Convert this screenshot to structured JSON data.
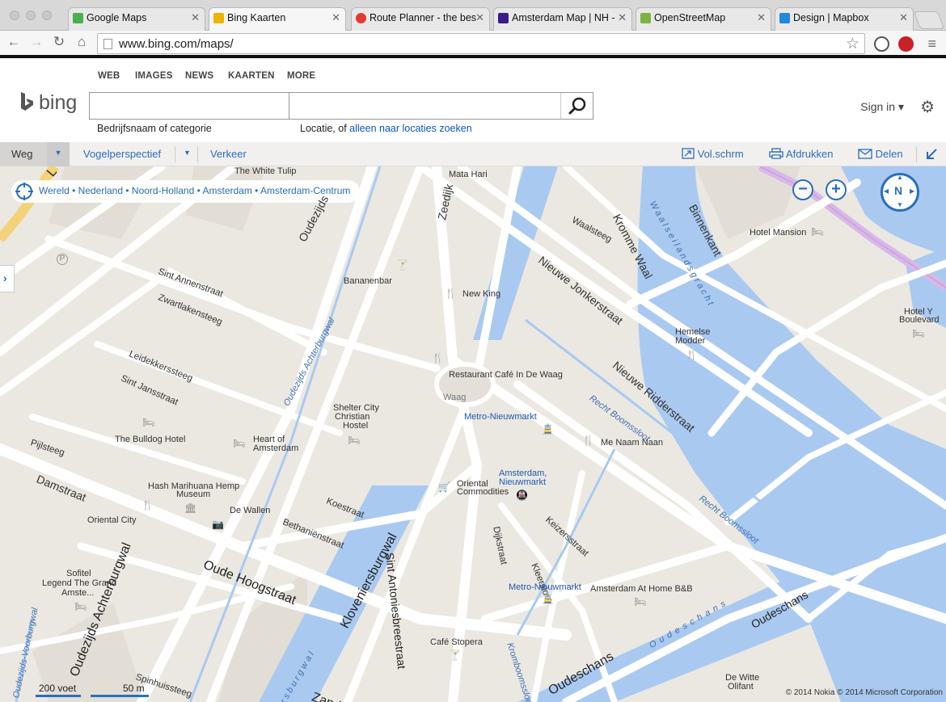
{
  "browser": {
    "tabs": [
      {
        "label": "Google Maps",
        "color": "#4caf50"
      },
      {
        "label": "Bing Kaarten",
        "color": "#f0b400"
      },
      {
        "label": "Route Planner - the bes",
        "color": "#e53935"
      },
      {
        "label": "Amsterdam Map | NH -",
        "color": "#3a1a8c"
      },
      {
        "label": "OpenStreetMap",
        "color": "#7cb342"
      },
      {
        "label": "Design | Mapbox",
        "color": "#1e88e5"
      }
    ],
    "url": "www.bing.com/maps/"
  },
  "header": {
    "scopes": [
      "WEB",
      "IMAGES",
      "NEWS",
      "KAARTEN",
      "MORE"
    ],
    "logo": "bing",
    "what_hint": "Bedrijfsnaam of categorie",
    "where_hint_prefix": "Locatie, of ",
    "where_hint_link": "alleen naar locaties zoeken",
    "signin": "Sign in",
    "signin_arrow": "▾"
  },
  "toolbar": {
    "road": "Weg",
    "birdseye": "Vogelperspectief",
    "traffic": "Verkeer",
    "fullscreen": "Vol.schrm",
    "print": "Afdrukken",
    "share": "Delen"
  },
  "map": {
    "breadcrumb": "Wereld • Nederland • Noord-Holland • Amsterdam • Amsterdam-Centrum",
    "compass": "N",
    "zoom_out": "−",
    "zoom_in": "+",
    "scale_imperial": "200 voet",
    "scale_metric": "50 m",
    "copyright": "© 2014 Nokia   © 2014 Microsoft Corporation",
    "streets": {
      "oudezijds_voorburgwal": "Oudezijds",
      "zeedijk": "Zeedijk",
      "kromme_waal": "Kromme Waal",
      "binnenkant": "Binnenkant",
      "waalseilandsgracht": "Waalseilandsgracht",
      "waalsteeg": "Waalsteeg",
      "nieuwe_jonkerstraat": "Nieuwe Jonkerstraat",
      "nieuwe_ridderstraat": "Nieuwe Ridderstraat",
      "recht_boomssloot_1": "Recht Boomssloot",
      "recht_boomssloot_2": "Recht Boomssloot",
      "sint_annenstraat": "Sint Annenstraat",
      "zwartlakensteeg": "Zwartlakensteeg",
      "leidekkerssteeg": "Leidekkerssteeg",
      "sint_jansstraat": "Sint Jansstraat",
      "oz_achterburgwal": "Oudezijds Achterburgwal",
      "pijlsteeg": "Pijlsteeg",
      "damstraat": "Damstraat",
      "koestraat": "Koestraat",
      "bethanienstraat": "Bethaniënstraat",
      "oude_hoogstraat": "Oude Hoogstraat",
      "oz_achterburgwal_2": "Oudezijds Achterburgwal",
      "kloveniersburgwal": "Kloveniersburgwal",
      "kloveniersburgwal_2": "rsburgwal",
      "sint_antoniesbreestraat": "Sint Antoniesbreestraat",
      "dijkstraat": "Dijkstraat",
      "keizersstraat": "Keizersstraat",
      "kleersloot": "Kleersloot",
      "oudeschans_water": "Oudeschans",
      "oudeschans": "Oudeschans",
      "oudeschans_2": "Oudeschans",
      "spinhuissteeg": "Spinhuissteeg",
      "oz_voorburgwal": "Oudezijds-Voorburgwal",
      "kromboomssloot": "Kromboomssloot",
      "zand": "Zand",
      "l_partial": "L"
    },
    "pois": {
      "white_tulip": "The White Tulip",
      "mata_hari": "Mata Hari",
      "hotel_mansion": "Hotel Mansion",
      "hotel_y": "Hotel Y",
      "boulevard": "Boulevard",
      "bananenbar": "Bananenbar",
      "new_king": "New King",
      "hemelse_modder_1": "Hemelse",
      "hemelse_modder_2": "Modder",
      "restaurant_waag": "Restaurant Café In De Waag",
      "waag": "Waag",
      "metro_nieuwmarkt": "Metro-Nieuwmarkt",
      "shelter_1": "Shelter City",
      "shelter_2": "Christian",
      "shelter_3": "Hostel",
      "me_naam_naan": "Me Naam Naan",
      "heart_1": "Heart of",
      "heart_2": "Amsterdam",
      "bulldog": "The Bulldog Hotel",
      "hash_1": "Hash Marihuana Hemp",
      "hash_2": "Museum",
      "ams_nieuwmarkt_1": "Amsterdam,",
      "ams_nieuwmarkt_2": "Nieuwmarkt",
      "oriental_1": "Oriental",
      "oriental_2": "Commodities",
      "oriental_city": "Oriental City",
      "de_wallen": "De Wallen",
      "sofitel_1": "Sofitel",
      "sofitel_2": "Legend The Grand",
      "sofitel_3": "Amste...",
      "metro_nieuwmarkt_2": "Metro-Nieuwmarkt",
      "ams_home": "Amsterdam At Home B&B",
      "cafe_stopera": "Café Stopera",
      "de_witte_1": "De Witte",
      "de_witte_2": "Olifant"
    }
  },
  "colors": {
    "accent": "#2a6ebb",
    "water": "#a9c9f0",
    "land": "#ebe8e2",
    "road": "#ffffff",
    "tram": "#d8b8e8"
  }
}
